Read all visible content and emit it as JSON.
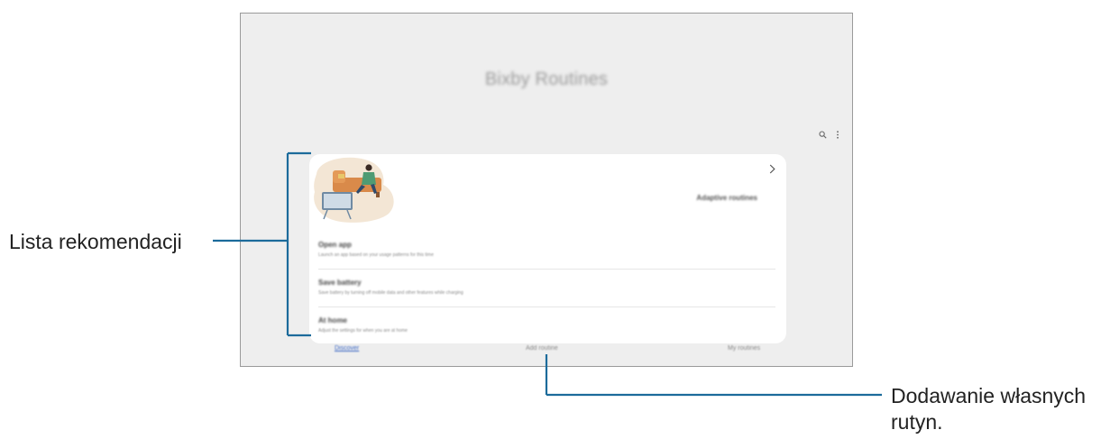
{
  "app": {
    "title": "Bixby Routines"
  },
  "icons": {
    "search": "search-icon",
    "more": "more-vertical-icon",
    "chevron": "chevron-right-icon"
  },
  "card": {
    "label": "Adaptive routines",
    "items": [
      {
        "title": "Open app",
        "description": "Launch an app based on your usage patterns for this time"
      },
      {
        "title": "Save battery",
        "description": "Save battery by turning off mobile data and other features while charging"
      },
      {
        "title": "At home",
        "description": "Adjust the settings for when you are at home"
      }
    ]
  },
  "bottom_nav": {
    "tabs": [
      {
        "label": "Discover",
        "active": true
      },
      {
        "label": "Add routine",
        "active": false
      },
      {
        "label": "My routines",
        "active": false
      }
    ]
  },
  "callouts": {
    "left": "Lista rekomendacji",
    "right_line1": "Dodawanie własnych",
    "right_line2": "rutyn."
  },
  "colors": {
    "callout_line": "#1c6b9b",
    "active_tab": "#3b67c4",
    "screen_bg": "#eeeeee"
  }
}
